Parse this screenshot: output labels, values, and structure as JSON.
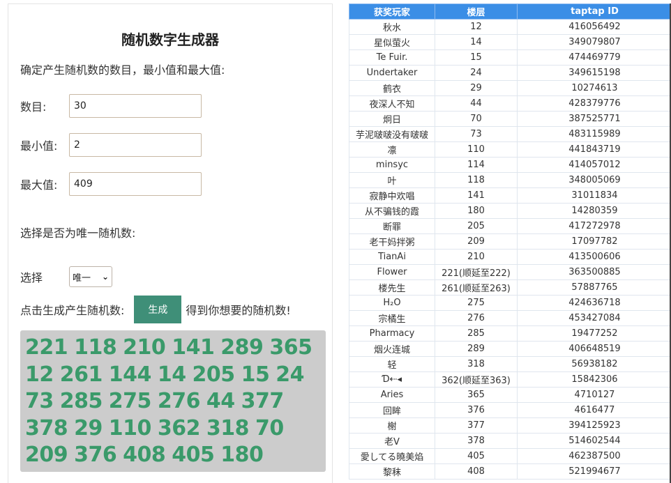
{
  "generator": {
    "title": "随机数字生成器",
    "instruction": "确定产生随机数的数目，最小值和最大值:",
    "count_label": "数目:",
    "count_value": "30",
    "min_label": "最小值:",
    "min_value": "2",
    "max_label": "最大值:",
    "max_value": "409",
    "unique_label": "选择是否为唯一随机数:",
    "select_label": "选择",
    "select_value": "唯一",
    "generate_before": "点击生成产生随机数:",
    "generate_button": "生成",
    "generate_after": "得到你想要的随机数!",
    "result": "221 118 210 141 289 365 12 261 144 14 205 15 24 73 285 275 276 44 377 378 29 110 362 318 70 209 376 408 405 180"
  },
  "colors": {
    "button": "#3f8f78",
    "result_text": "#3a9a6a",
    "result_bg": "#cccccc",
    "table_header": "#3b8ee6"
  },
  "table": {
    "headers": [
      "获奖玩家",
      "楼层",
      "taptap ID"
    ],
    "rows": [
      [
        "秋水",
        "12",
        "416056492"
      ],
      [
        "星似萤火",
        "14",
        "349079807"
      ],
      [
        "Te Fuir.",
        "15",
        "474469779"
      ],
      [
        "Undertaker",
        "24",
        "349615198"
      ],
      [
        "鹤衣",
        "29",
        "10274613"
      ],
      [
        "夜深人不知",
        "44",
        "428379776"
      ],
      [
        "炯日",
        "70",
        "387525771"
      ],
      [
        "芋泥啵啵没有啵啵",
        "73",
        "483115989"
      ],
      [
        "凛",
        "110",
        "441843719"
      ],
      [
        "minsyc",
        "114",
        "414057012"
      ],
      [
        "叶",
        "118",
        "348005069"
      ],
      [
        "寂静中欢唱",
        "141",
        "31011834"
      ],
      [
        "从不骗钱的霞",
        "180",
        "14280359"
      ],
      [
        "断罪",
        "205",
        "417272978"
      ],
      [
        "老干妈拌粥",
        "209",
        "17097782"
      ],
      [
        "TianAi",
        "210",
        "413500606"
      ],
      [
        "Flower",
        "221(顺延至222)",
        "363500885"
      ],
      [
        "楼先生",
        "261(顺延至263)",
        "57887765"
      ],
      [
        "H₂O",
        "275",
        "424636718"
      ],
      [
        "宗橘生",
        "276",
        "453427084"
      ],
      [
        "Pharmacy",
        "285",
        "19477252"
      ],
      [
        "烟火连城",
        "289",
        "406648519"
      ],
      [
        "轻",
        "318",
        "56938182"
      ],
      [
        "Ɗ⇠◂",
        "362(顺延至363)",
        "15842306"
      ],
      [
        "Aries",
        "365",
        "4710127"
      ],
      [
        "回眸",
        "376",
        "4616477"
      ],
      [
        "榭",
        "377",
        "394125923"
      ],
      [
        "老V",
        "378",
        "514602544"
      ],
      [
        "愛してる曉美焰",
        "405",
        "462387500"
      ],
      [
        "黎秣",
        "408",
        "521994677"
      ]
    ]
  }
}
